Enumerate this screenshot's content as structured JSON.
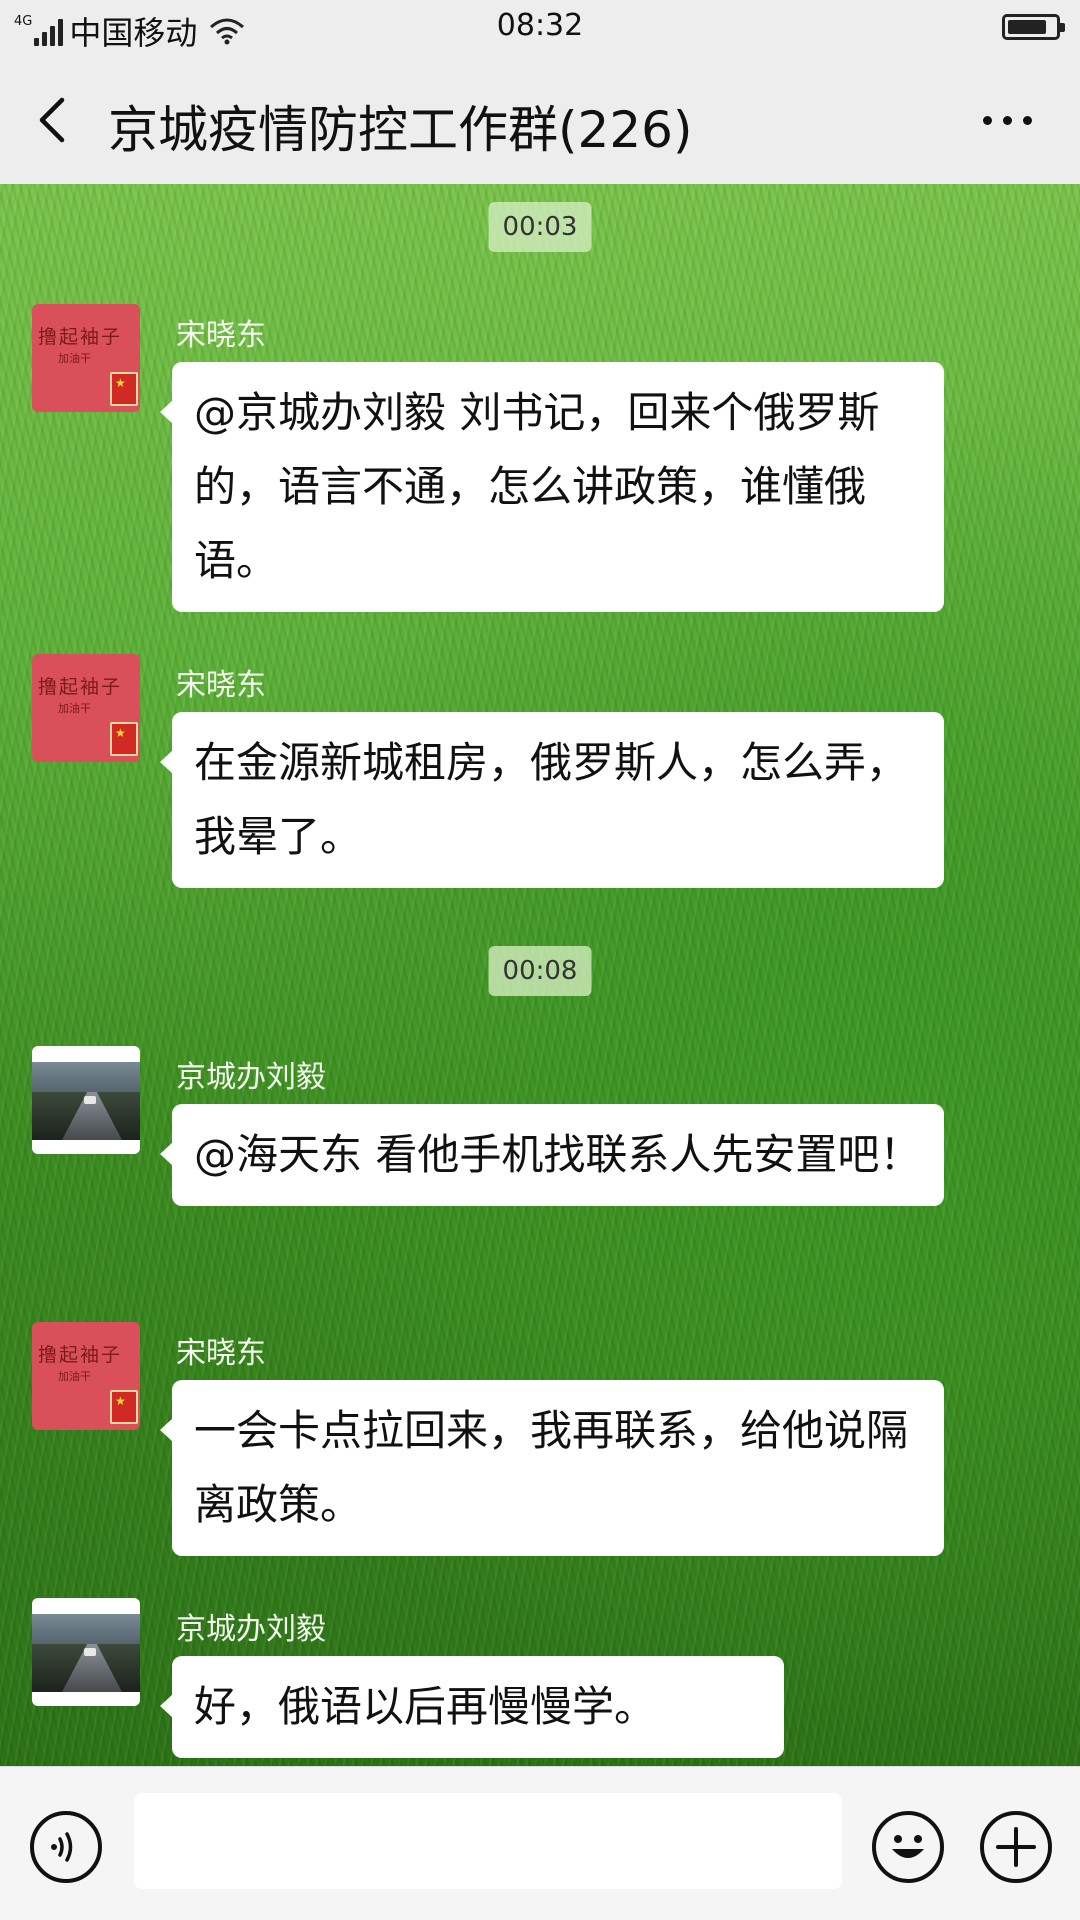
{
  "status_bar": {
    "network_type": "4G",
    "carrier": "中国移动",
    "time": "08:32"
  },
  "header": {
    "title": "京城疫情防控工作群(226)"
  },
  "chat": {
    "timestamps": [
      "00:03",
      "00:08"
    ],
    "messages": [
      {
        "sender": "宋晓东",
        "avatar": "calligraphy-flag-avatar",
        "text": "@京城办刘毅  刘书记，回来个俄罗斯的，语言不通，怎么讲政策，谁懂俄语。"
      },
      {
        "sender": "宋晓东",
        "avatar": "calligraphy-flag-avatar",
        "text": "在金源新城租房，俄罗斯人，怎么弄，我晕了。"
      },
      {
        "sender": "京城办刘毅",
        "avatar": "road-photo-avatar",
        "text": "@海天东  看他手机找联系人先安置吧！"
      },
      {
        "sender": "宋晓东",
        "avatar": "calligraphy-flag-avatar",
        "text": "一会卡点拉回来，我再联系，给他说隔离政策。"
      },
      {
        "sender": "京城办刘毅",
        "avatar": "road-photo-avatar",
        "text": "好，俄语以后再慢慢学。"
      }
    ]
  },
  "avatar_text": {
    "line1": "撸起袖子",
    "line2": "加油干"
  },
  "input_bar": {
    "placeholder": "",
    "icons": [
      "voice-icon",
      "emoji-icon",
      "plus-icon"
    ]
  },
  "colors": {
    "bubble": "#ffffff",
    "header_bg": "#ededed",
    "avatar_red": "#d9505a",
    "grass": "#4fa32d"
  }
}
